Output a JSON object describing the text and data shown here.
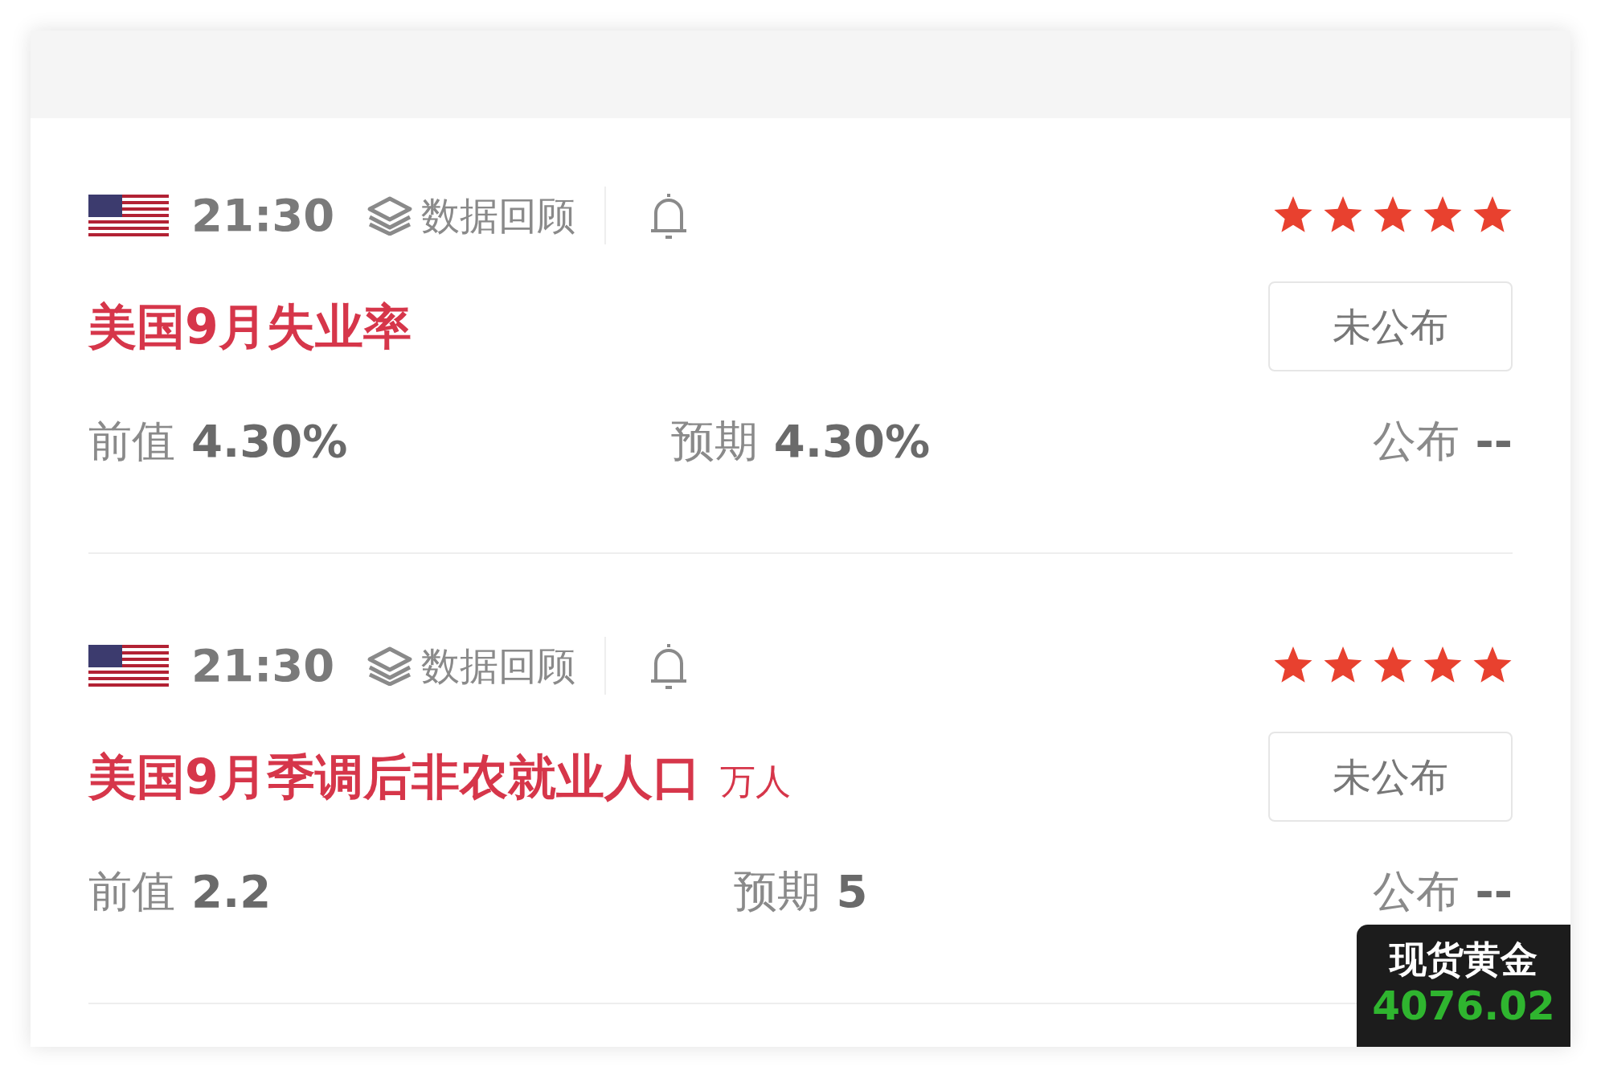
{
  "events": [
    {
      "time": "21:30",
      "review_label": "数据回顾",
      "stars": 5,
      "title": "美国9月失业率",
      "status": "未公布",
      "values": [
        {
          "label": "前值",
          "value": "4.30%"
        },
        {
          "label": "预期",
          "value": "4.30%"
        },
        {
          "label": "公布",
          "value": "--"
        }
      ]
    },
    {
      "time": "21:30",
      "review_label": "数据回顾",
      "stars": 5,
      "title": "美国9月季调后非农就业人口",
      "unit": "万人",
      "status": "未公布",
      "values": [
        {
          "label": "前值",
          "value": "2.2"
        },
        {
          "label": "预期",
          "value": "5"
        },
        {
          "label": "公布",
          "value": "--"
        }
      ]
    }
  ],
  "ticker": {
    "name": "现货黄金",
    "price": "4076.02"
  }
}
